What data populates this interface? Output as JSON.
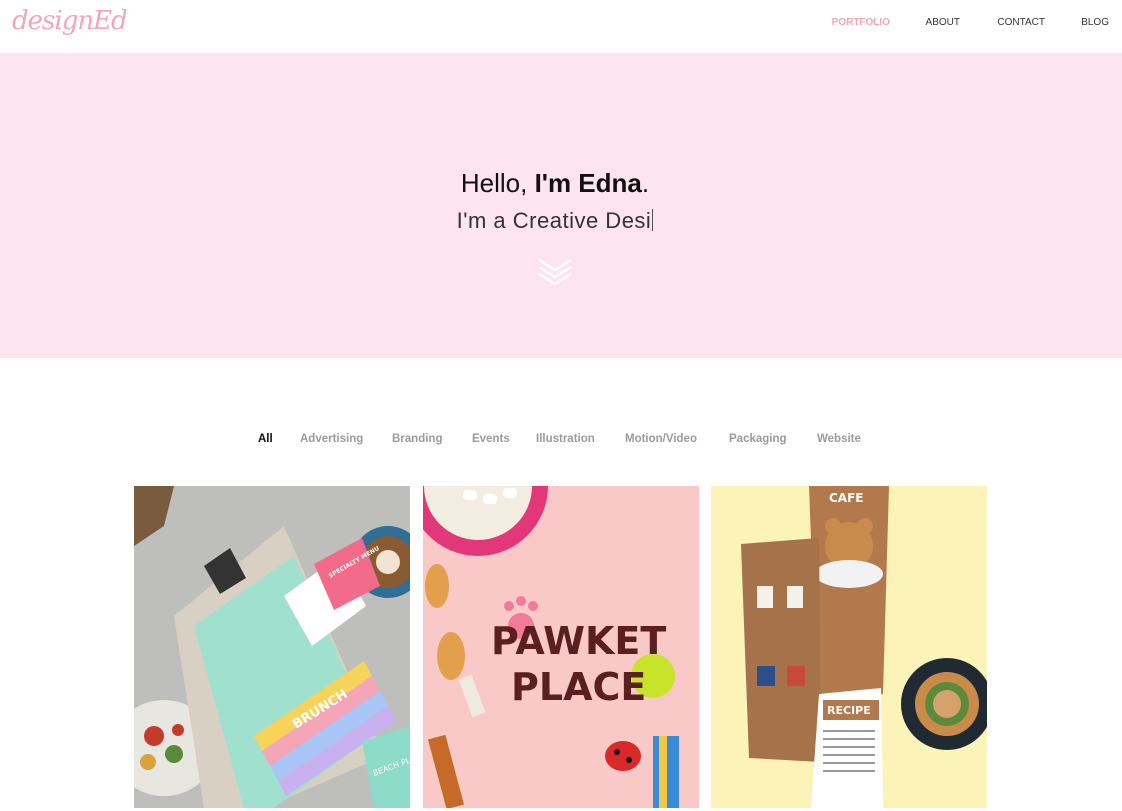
{
  "brand": {
    "logo_text": "designEd"
  },
  "nav": {
    "items": [
      "PORTFOLIO",
      "ABOUT",
      "CONTACT",
      "BLOG"
    ],
    "active": "PORTFOLIO"
  },
  "hero": {
    "greeting": "Hello, ",
    "name": "I'm Edna",
    "punct": ".",
    "subtitle": "I'm a Creative Desi"
  },
  "filters": {
    "items": [
      "All",
      "Advertising",
      "Branding",
      "Events",
      "Illustration",
      "Motion/Video",
      "Packaging",
      "Website"
    ],
    "active": "All"
  },
  "portfolio": {
    "items": [
      {
        "name": "brunch-menu",
        "lines": [
          "BRUNCH",
          "SPECIALTY MENU",
          "BEACH PLEASE"
        ]
      },
      {
        "name": "pawket-place",
        "lines": [
          "PAWKET",
          "PLACE"
        ]
      },
      {
        "name": "cafe-recipe",
        "lines": [
          "CAFE",
          "RECIPE"
        ]
      }
    ]
  },
  "colors": {
    "accent": "#f4a5b8",
    "hero_bg": "#fde4ee",
    "text": "#111111",
    "muted": "#9b9b9b"
  }
}
